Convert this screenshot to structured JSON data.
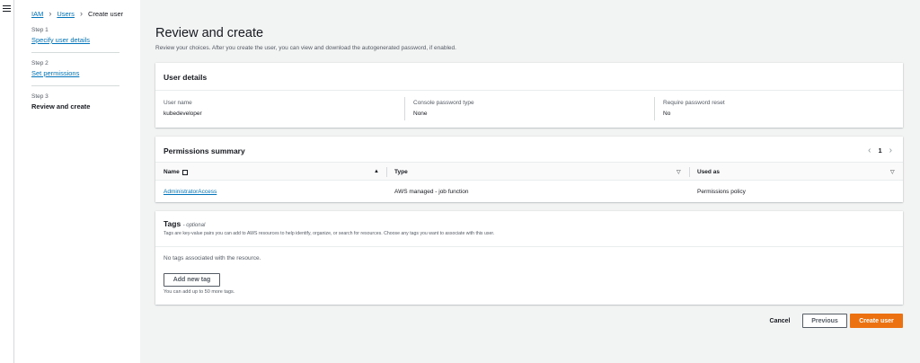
{
  "breadcrumb": {
    "items": [
      "IAM",
      "Users"
    ],
    "current": "Create user"
  },
  "steps": [
    {
      "num": "Step 1",
      "label": "Specify user details"
    },
    {
      "num": "Step 2",
      "label": "Set permissions"
    },
    {
      "num": "Step 3",
      "label": "Review and create"
    }
  ],
  "page": {
    "title": "Review and create",
    "subtitle": "Review your choices. After you create the user, you can view and download the autogenerated password, if enabled."
  },
  "user_details": {
    "heading": "User details",
    "fields": [
      {
        "label": "User name",
        "value": "kubedeveloper"
      },
      {
        "label": "Console password type",
        "value": "None"
      },
      {
        "label": "Require password reset",
        "value": "No"
      }
    ]
  },
  "permissions": {
    "heading": "Permissions summary",
    "page": "1",
    "columns": [
      "Name",
      "Type",
      "Used as"
    ],
    "rows": [
      {
        "name": "AdministratorAccess",
        "type": "AWS managed - job function",
        "used_as": "Permissions policy"
      }
    ]
  },
  "tags": {
    "heading": "Tags",
    "optional": "- optional",
    "description": "Tags are key-value pairs you can add to AWS resources to help identify, organize, or search for resources. Choose any tags you want to associate with this user.",
    "empty": "No tags associated with the resource.",
    "add_button": "Add new tag",
    "limit_note": "You can add up to 50 more tags."
  },
  "actions": {
    "cancel": "Cancel",
    "previous": "Previous",
    "create": "Create user"
  },
  "colors": {
    "accent": "#ec7211",
    "link": "#0073bb"
  }
}
